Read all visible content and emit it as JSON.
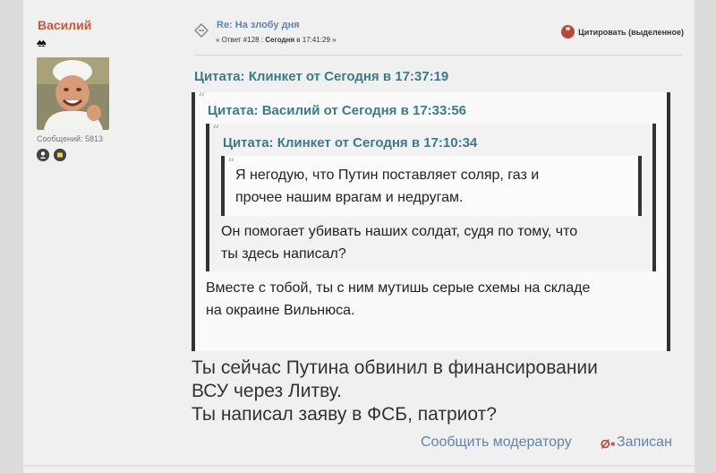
{
  "poster": {
    "name": "Василий",
    "rank_glyphs": "♠♠",
    "posts_label": "Сообщений: 5813"
  },
  "header": {
    "topic_title": "Re: На злобу дня",
    "reply_prefix": "« Ответ #128 : ",
    "reply_day": "Сегодня",
    "reply_time_suffix": " в 17:41:29 »",
    "quote_button": "Цитировать (выделенное)"
  },
  "quotes": {
    "outer_cite": "Цитата: Клинкет от Сегодня в 17:37:19",
    "middle_cite": "Цитата: Василий от Сегодня в 17:33:56",
    "inner_cite": "Цитата: Клинкет от Сегодня в 17:10:34",
    "inner_text": [
      "Я негодую, что Путин поставляет соляр, газ и",
      "прочее нашим врагам и недругам."
    ],
    "middle_text": [
      "Он помогает убивать наших солдат, судя по тому, что",
      "ты здесь написал?"
    ],
    "outer_text": [
      "Вместе с тобой, ты с ним мутишь серые схемы на складе",
      "на окраине Вильнюса."
    ]
  },
  "body": {
    "lines": [
      "Ты сейчас Путина обвинил в финансировании",
      "ВСУ через Литву.",
      "Ты написал заяву в ФСБ, патриот?"
    ]
  },
  "footer": {
    "report_link": "Сообщить модератору",
    "logged_link": "Записан"
  }
}
